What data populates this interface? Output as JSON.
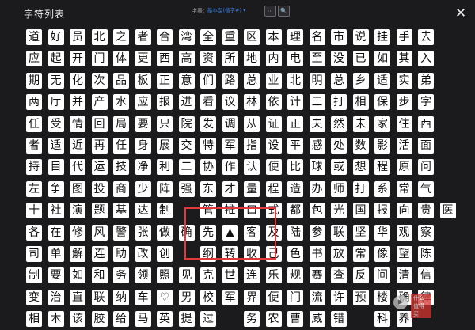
{
  "window": {
    "title": "字符列表",
    "close_icon": "✕"
  },
  "toolbar": {
    "font_label": "字表：",
    "font_value": "基本型(楷字#) ▾",
    "btn1": "⋯",
    "btn2": "🔍"
  },
  "watermark": {
    "play_icon": "▶",
    "badge": "什么值得买"
  },
  "rows": [
    [
      "道",
      "好",
      "员",
      "北",
      "之",
      "者",
      "合",
      "湾",
      "全",
      "重",
      "区",
      "本",
      "理",
      "名",
      "市",
      "说",
      "挂",
      "手",
      "去"
    ],
    [
      "应",
      "起",
      "开",
      "门",
      "体",
      "更",
      "西",
      "高",
      "资",
      "所",
      "地",
      "内",
      "电",
      "至",
      "没",
      "已",
      "如",
      "其",
      "入"
    ],
    [
      "期",
      "无",
      "化",
      "次",
      "品",
      "板",
      "正",
      "意",
      "们",
      "路",
      "总",
      "业",
      "北",
      "明",
      "总",
      "乡",
      "适",
      "实",
      "弟"
    ],
    [
      "两",
      "厅",
      "并",
      "产",
      "水",
      "应",
      "报",
      "进",
      "看",
      "议",
      "林",
      "依",
      "计",
      "三",
      "打",
      "相",
      "保",
      "步",
      "字"
    ],
    [
      "任",
      "受",
      "情",
      "回",
      "局",
      "要",
      "只",
      "院",
      "发",
      "调",
      "从",
      "证",
      "正",
      "夫",
      "然",
      "未",
      "家",
      "住",
      "西"
    ],
    [
      "者",
      "适",
      "近",
      "再",
      "任",
      "身",
      "展",
      "交",
      "特",
      "军",
      "指",
      "设",
      "平",
      "感",
      "处",
      "数",
      "影",
      "活",
      "面"
    ],
    [
      "持",
      "目",
      "代",
      "运",
      "技",
      "净",
      "利",
      "二",
      "协",
      "作",
      "认",
      "便",
      "比",
      "球",
      "或",
      "想",
      "程",
      "原",
      "问"
    ],
    [
      "左",
      "争",
      "图",
      "投",
      "商",
      "少",
      "阵",
      "强",
      "东",
      "才",
      "量",
      "程",
      "造",
      "办",
      "师",
      "打",
      "系",
      "常",
      "气"
    ],
    [
      "十",
      "社",
      "演",
      "题",
      "基",
      "达",
      "制",
      "",
      "管",
      "推",
      "口",
      "式",
      "都",
      "包",
      "光",
      "国",
      "报",
      "向",
      "贵",
      "医"
    ],
    [
      "各",
      "在",
      "修",
      "风",
      "警",
      "张",
      "做",
      "确",
      "先",
      "▲",
      "客",
      "及",
      "陆",
      "参",
      "联",
      "坚",
      "华",
      "观",
      "察"
    ],
    [
      "司",
      "单",
      "解",
      "连",
      "助",
      "改",
      "创",
      "",
      "纲",
      "转",
      "收",
      "己",
      "色",
      "书",
      "放",
      "常",
      "像",
      "望",
      "陈"
    ],
    [
      "制",
      "要",
      "如",
      "和",
      "务",
      "领",
      "照",
      "见",
      "克",
      "世",
      "连",
      "乐",
      "规",
      "赛",
      "查",
      "反",
      "间",
      "清",
      "信"
    ],
    [
      "变",
      "治",
      "直",
      "联",
      "纳",
      "车",
      "♡",
      "男",
      "校",
      "军",
      "界",
      "便",
      "门",
      "流",
      "许",
      "预",
      "楼",
      "确",
      "律"
    ],
    [
      "相",
      "木",
      "该",
      "胶",
      "给",
      "马",
      "英",
      "提",
      "过",
      "",
      "务",
      "农",
      "曹",
      "威",
      "错",
      "",
      "科",
      "养",
      ""
    ]
  ]
}
